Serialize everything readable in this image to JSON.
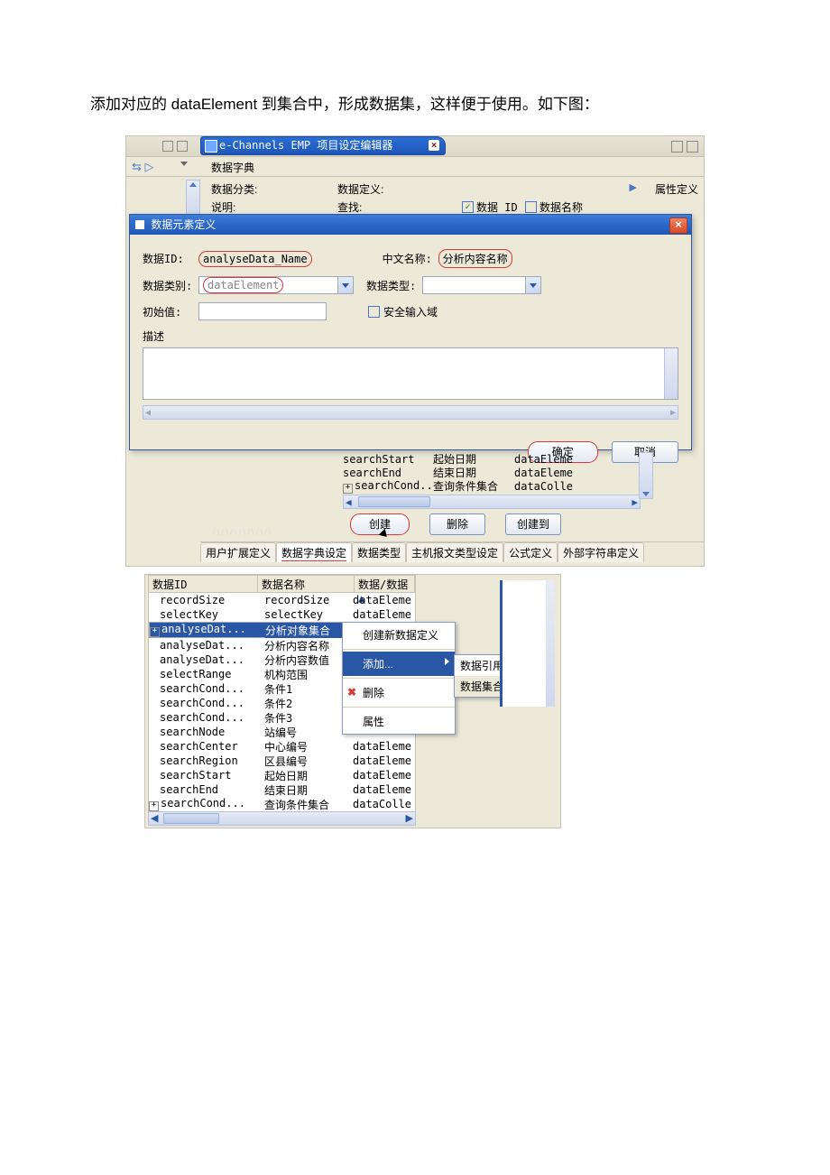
{
  "caption": "添加对应的 dataElement 到集合中，形成数据集，这样便于使用。如下图：",
  "editor_tab": "e-Channels EMP 项目设定编辑器",
  "row2_label": "数据字典",
  "row3": {
    "l1": "数据分类:",
    "l2": "数据定义:",
    "l3": "属性定义"
  },
  "row4": {
    "l1": "说明:",
    "l2": "查找:",
    "cb1": "数据 ID",
    "cb2": "数据名称"
  },
  "dialog": {
    "title": "数据元素定义",
    "data_id_label": "数据ID:",
    "data_id_value": "analyseData_Name",
    "cn_name_label": "中文名称:",
    "cn_name_value": "分析内容名称",
    "category_label": "数据类别:",
    "category_value": "dataElement",
    "type_label": "数据类型:",
    "init_label": "初始值:",
    "secure_label": "安全输入域",
    "desc_label": "描述",
    "ok": "确定",
    "cancel": "取消"
  },
  "mid_rows": [
    {
      "c1": "searchStart",
      "c2": "起始日期",
      "c3": "dataEleme"
    },
    {
      "c1": "searchEnd",
      "c2": "结束日期",
      "c3": "dataEleme"
    },
    {
      "c1": "searchCond...",
      "c2": "查询条件集合",
      "c3": "dataColle",
      "exp": true
    }
  ],
  "actions": {
    "create": "创建",
    "delete": "删除",
    "create_to": "创建到"
  },
  "tabs": [
    "用户扩展定义",
    "数据字典设定",
    "数据类型",
    "主机报文类型设定",
    "公式定义",
    "外部字符串定义"
  ],
  "tbl2": {
    "hdr": [
      "数据ID",
      "数据名称",
      "数据/数据"
    ],
    "rows": [
      {
        "c1": "recordSize",
        "c2": "recordSize",
        "c3": "dataEleme"
      },
      {
        "c1": "selectKey",
        "c2": "selectKey",
        "c3": "dataEleme"
      },
      {
        "c1": "analyseDat...",
        "c2": "分析对象集合",
        "c3": "",
        "exp": true,
        "sel": true
      },
      {
        "c1": "analyseDat...",
        "c2": "分析内容名称",
        "c3": ""
      },
      {
        "c1": "analyseDat...",
        "c2": "分析内容数值",
        "c3": ""
      },
      {
        "c1": "selectRange",
        "c2": "机构范围",
        "c3": ""
      },
      {
        "c1": "searchCond...",
        "c2": "条件1",
        "c3": ""
      },
      {
        "c1": "searchCond...",
        "c2": "条件2",
        "c3": ""
      },
      {
        "c1": "searchCond...",
        "c2": "条件3",
        "c3": ""
      },
      {
        "c1": "searchNode",
        "c2": "站编号",
        "c3": ""
      },
      {
        "c1": "searchCenter",
        "c2": "中心编号",
        "c3": "dataEleme"
      },
      {
        "c1": "searchRegion",
        "c2": "区县编号",
        "c3": "dataEleme"
      },
      {
        "c1": "searchStart",
        "c2": "起始日期",
        "c3": "dataEleme"
      },
      {
        "c1": "searchEnd",
        "c2": "结束日期",
        "c3": "dataEleme"
      },
      {
        "c1": "searchCond...",
        "c2": "查询条件集合",
        "c3": "dataColle",
        "exp": true
      }
    ]
  },
  "ctxmenu": {
    "m1": "创建新数据定义",
    "m2": "添加...",
    "m3": "删除",
    "m4": "属性"
  },
  "submenu": {
    "s1": "数据引用",
    "s2": "数据集合"
  }
}
